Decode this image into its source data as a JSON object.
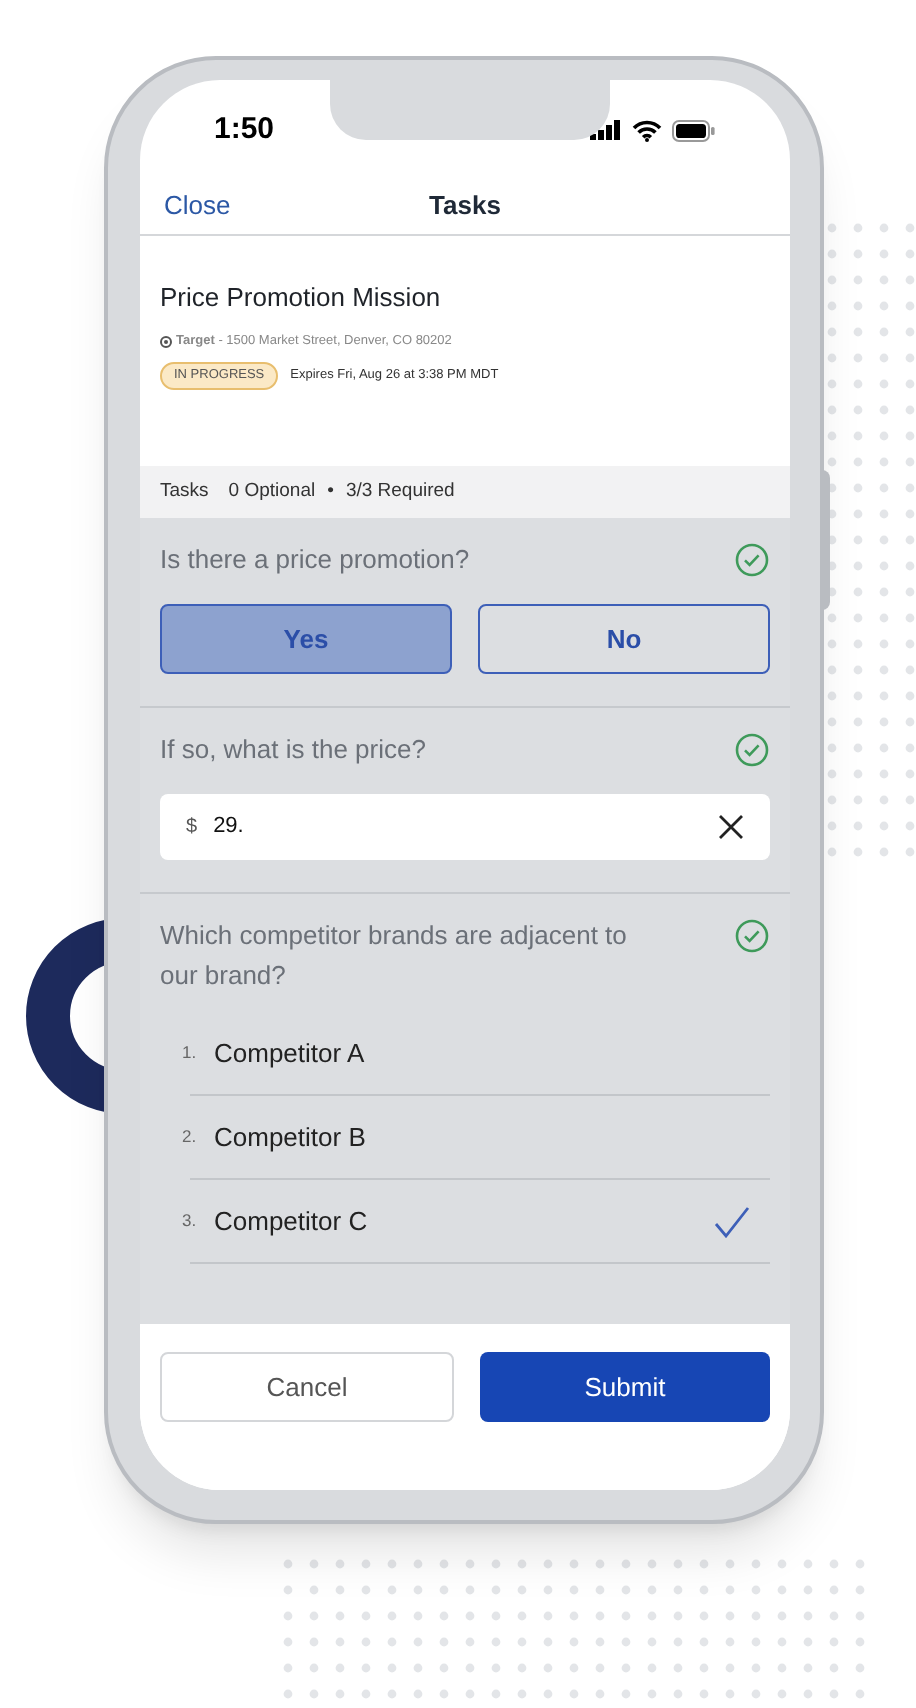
{
  "status_bar": {
    "time": "1:50"
  },
  "nav": {
    "close": "Close",
    "title": "Tasks"
  },
  "mission": {
    "title": "Price Promotion Mission",
    "location": "**Target** - 1500 Market Street, Denver, CO 80202",
    "status": "IN PROGRESS",
    "expires": "Expires Fri, Aug 26 at 3:38 PM MDT"
  },
  "tasks_bar": {
    "label": "Tasks",
    "optional": "0 Optional",
    "separator": "•",
    "required": "3/3 Required"
  },
  "questions": [
    {
      "kind": "choice",
      "text": "Is there a price promotion?",
      "complete": true,
      "options": [
        {
          "label": "Yes",
          "selected": true
        },
        {
          "label": "No",
          "selected": false
        }
      ]
    },
    {
      "kind": "input",
      "text": "If so, what is the price?",
      "complete": true,
      "prefix": "$",
      "value": "29."
    },
    {
      "kind": "list",
      "text": "Which competitor brands are adjacent to our brand?",
      "complete": true,
      "items": [
        {
          "number": "1.",
          "label": "Competitor A",
          "checked": false
        },
        {
          "number": "2.",
          "label": "Competitor B",
          "checked": false
        },
        {
          "number": "3.",
          "label": "Competitor C",
          "checked": true
        }
      ]
    }
  ],
  "footer": {
    "cancel": "Cancel",
    "submit": "Submit"
  }
}
